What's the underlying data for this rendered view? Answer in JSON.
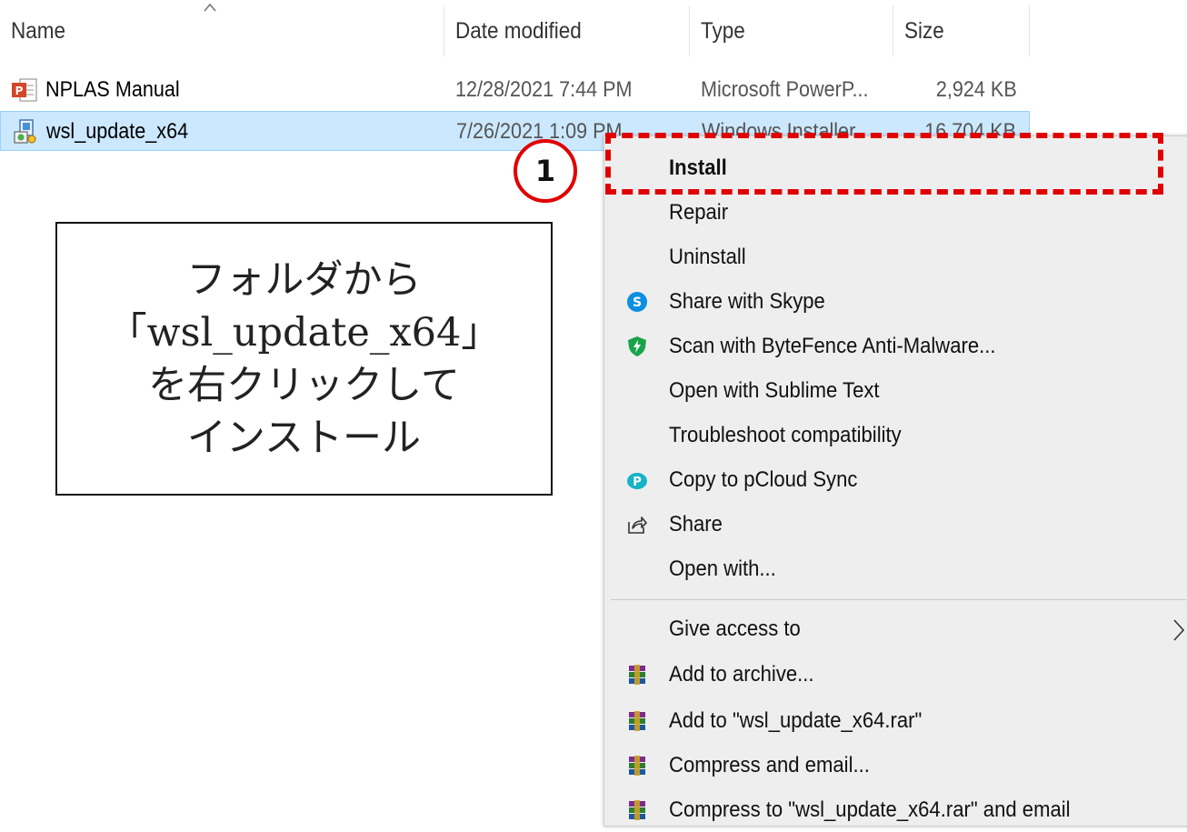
{
  "columns": {
    "name": "Name",
    "date_modified": "Date modified",
    "type": "Type",
    "size": "Size"
  },
  "files": [
    {
      "name": "NPLAS Manual",
      "date": "12/28/2021 7:44 PM",
      "type": "Microsoft PowerP...",
      "size": "2,924 KB",
      "icon": "powerpoint-icon"
    },
    {
      "name": "wsl_update_x64",
      "date": "7/26/2021 1:09 PM",
      "type": "Windows Installer",
      "size": "16,704 KB",
      "icon": "installer-icon"
    }
  ],
  "annotation": {
    "step_number": "1",
    "text": "フォルダから\n「wsl_update_x64」\nを右クリックして\nインストール",
    "highlight_color": "#e00000"
  },
  "context_menu": {
    "items": [
      {
        "label": "Install",
        "bold": true
      },
      {
        "label": "Repair"
      },
      {
        "label": "Uninstall"
      },
      {
        "label": "Share with Skype",
        "icon": "skype-icon"
      },
      {
        "label": "Scan with ByteFence Anti-Malware...",
        "icon": "bytefence-shield-icon"
      },
      {
        "label": "Open with Sublime Text"
      },
      {
        "label": "Troubleshoot compatibility"
      },
      {
        "label": "Copy to pCloud Sync",
        "icon": "pcloud-icon"
      },
      {
        "label": "Share",
        "icon": "share-icon"
      },
      {
        "label": "Open with..."
      },
      {
        "label": "Give access to",
        "submenu": true
      },
      {
        "label": "Add to archive...",
        "icon": "winrar-icon"
      },
      {
        "label": "Add to \"wsl_update_x64.rar\"",
        "icon": "winrar-icon"
      },
      {
        "label": "Compress and email...",
        "icon": "winrar-icon"
      },
      {
        "label": "Compress to \"wsl_update_x64.rar\" and email",
        "icon": "winrar-icon"
      }
    ]
  }
}
